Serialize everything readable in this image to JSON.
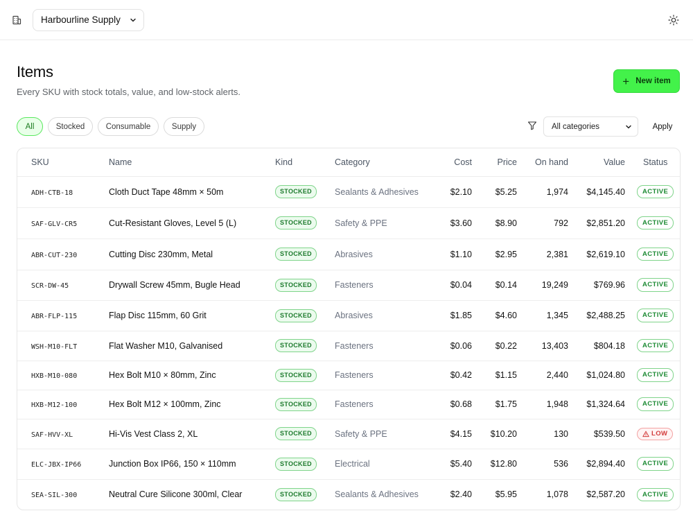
{
  "org": {
    "selected": "Harbourline Supply"
  },
  "header": {
    "title": "Items",
    "subtitle": "Every SKU with stock totals, value, and low-stock alerts.",
    "new_label": "New item"
  },
  "filters": {
    "chips": [
      "All",
      "Stocked",
      "Consumable",
      "Supply"
    ],
    "active_chip": "All",
    "category_selected": "All categories",
    "apply_label": "Apply"
  },
  "table": {
    "columns": [
      "SKU",
      "Name",
      "Kind",
      "Category",
      "Cost",
      "Price",
      "On hand",
      "Value",
      "Status"
    ],
    "rows": [
      {
        "sku": "ADH-CTB-18",
        "name": "Cloth Duct Tape 48mm × 50m",
        "kind": "STOCKED",
        "category": "Sealants & Adhesives",
        "cost": "$2.10",
        "price": "$5.25",
        "on_hand": "1,974",
        "value": "$4,145.40",
        "status": "ACTIVE"
      },
      {
        "sku": "SAF-GLV-CR5",
        "name": "Cut-Resistant Gloves, Level 5 (L)",
        "kind": "STOCKED",
        "category": "Safety & PPE",
        "cost": "$3.60",
        "price": "$8.90",
        "on_hand": "792",
        "value": "$2,851.20",
        "status": "ACTIVE"
      },
      {
        "sku": "ABR-CUT-230",
        "name": "Cutting Disc 230mm, Metal",
        "kind": "STOCKED",
        "category": "Abrasives",
        "cost": "$1.10",
        "price": "$2.95",
        "on_hand": "2,381",
        "value": "$2,619.10",
        "status": "ACTIVE"
      },
      {
        "sku": "SCR-DW-45",
        "name": "Drywall Screw 45mm, Bugle Head",
        "kind": "STOCKED",
        "category": "Fasteners",
        "cost": "$0.04",
        "price": "$0.14",
        "on_hand": "19,249",
        "value": "$769.96",
        "status": "ACTIVE"
      },
      {
        "sku": "ABR-FLP-115",
        "name": "Flap Disc 115mm, 60 Grit",
        "kind": "STOCKED",
        "category": "Abrasives",
        "cost": "$1.85",
        "price": "$4.60",
        "on_hand": "1,345",
        "value": "$2,488.25",
        "status": "ACTIVE"
      },
      {
        "sku": "WSH-M10-FLT",
        "name": "Flat Washer M10, Galvanised",
        "kind": "STOCKED",
        "category": "Fasteners",
        "cost": "$0.06",
        "price": "$0.22",
        "on_hand": "13,403",
        "value": "$804.18",
        "status": "ACTIVE"
      },
      {
        "sku": "HXB-M10-080",
        "name": "Hex Bolt M10 × 80mm, Zinc",
        "kind": "STOCKED",
        "category": "Fasteners",
        "cost": "$0.42",
        "price": "$1.15",
        "on_hand": "2,440",
        "value": "$1,024.80",
        "status": "ACTIVE"
      },
      {
        "sku": "HXB-M12-100",
        "name": "Hex Bolt M12 × 100mm, Zinc",
        "kind": "STOCKED",
        "category": "Fasteners",
        "cost": "$0.68",
        "price": "$1.75",
        "on_hand": "1,948",
        "value": "$1,324.64",
        "status": "ACTIVE"
      },
      {
        "sku": "SAF-HVV-XL",
        "name": "Hi-Vis Vest Class 2, XL",
        "kind": "STOCKED",
        "category": "Safety & PPE",
        "cost": "$4.15",
        "price": "$10.20",
        "on_hand": "130",
        "value": "$539.50",
        "status": "LOW"
      },
      {
        "sku": "ELC-JBX-IP66",
        "name": "Junction Box IP66, 150 × 110mm",
        "kind": "STOCKED",
        "category": "Electrical",
        "cost": "$5.40",
        "price": "$12.80",
        "on_hand": "536",
        "value": "$2,894.40",
        "status": "ACTIVE"
      },
      {
        "sku": "SEA-SIL-300",
        "name": "Neutral Cure Silicone 300ml, Clear",
        "kind": "STOCKED",
        "category": "Sealants & Adhesives",
        "cost": "$2.40",
        "price": "$5.95",
        "on_hand": "1,078",
        "value": "$2,587.20",
        "status": "ACTIVE"
      }
    ]
  },
  "colors": {
    "accent": "#43f24a",
    "active": "#1c8a33",
    "low": "#d23b3b"
  },
  "icons": {
    "org": "building-icon",
    "theme": "sun-icon",
    "filter": "filter-icon",
    "warning": "warning-icon"
  }
}
